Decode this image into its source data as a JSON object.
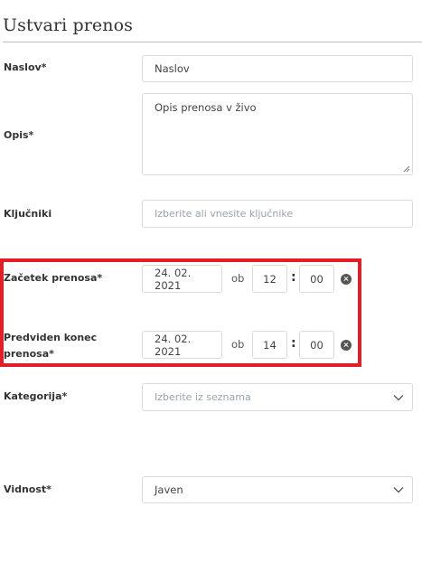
{
  "page": {
    "title": "Ustvari prenos"
  },
  "form": {
    "title_field": {
      "label": "Naslov*",
      "value": "Naslov"
    },
    "description_field": {
      "label": "Opis*",
      "value": "Opis prenosa v živo"
    },
    "keywords_field": {
      "label": "Ključniki",
      "placeholder": "Izberite ali vnesite ključnike"
    },
    "start": {
      "label": "Začetek prenosa*",
      "date": "24. 02. 2021",
      "at": "ob",
      "hour": "12",
      "colon": ":",
      "minute": "00"
    },
    "end": {
      "label": "Predviden konec prenosa*",
      "date": "24. 02. 2021",
      "at": "ob",
      "hour": "14",
      "colon": ":",
      "minute": "00"
    },
    "category": {
      "label": "Kategorija*",
      "placeholder": "Izberite iz seznama"
    },
    "visibility": {
      "label": "Vidnost*",
      "value": "Javen"
    }
  },
  "colors": {
    "highlight": "#e41e26",
    "border": "#dadada",
    "placeholder": "#9aa3ad"
  },
  "icons": {
    "clear": "clear-circle-icon",
    "dropdown": "chevron-down-icon",
    "resize": "resize-grip-icon"
  }
}
